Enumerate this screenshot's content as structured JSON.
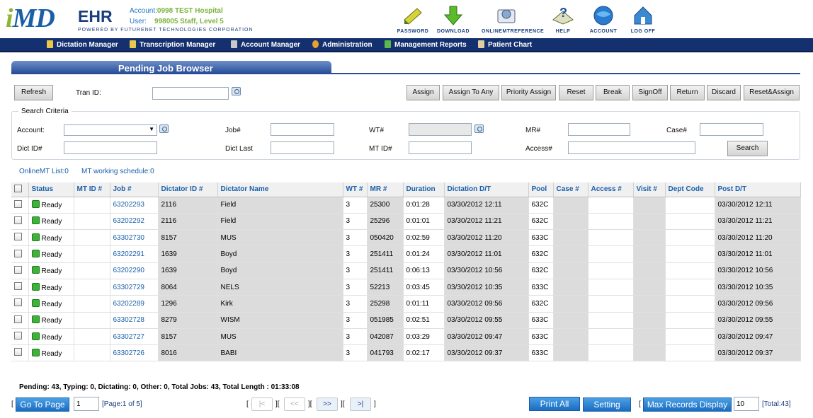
{
  "header": {
    "logo_i": "i",
    "logo_md": "MD",
    "logo_ehr": "EHR",
    "powered": "POWERED BY FUTURENET TECHNOLOGIES CORPORATION",
    "account_label": "Account:",
    "account_value": "0998 TEST Hospital",
    "user_label": "User:",
    "user_value": "998005 Staff, Level 5",
    "tools": [
      "PASSWORD",
      "DOWNLOAD",
      "ONLINEMTREFERENCE",
      "HELP",
      "ACCOUNT",
      "LOG OFF"
    ]
  },
  "nav": [
    "Dictation Manager",
    "Transcription Manager",
    "Account Manager",
    "Administration",
    "Management Reports",
    "Patient Chart"
  ],
  "title": "Pending Job Browser",
  "toolbar": {
    "refresh": "Refresh",
    "tran_id_label": "Tran ID:",
    "assign": "Assign",
    "assign_any": "Assign To Any",
    "priority_assign": "Priority Assign",
    "reset": "Reset",
    "break": "Break",
    "signoff": "SignOff",
    "return": "Return",
    "discard": "Discard",
    "reset_assign": "Reset&Assign"
  },
  "criteria": {
    "legend": "Search Criteria",
    "account": "Account:",
    "job": "Job#",
    "wt": "WT#",
    "mr": "MR#",
    "case": "Case#",
    "dict_id": "Dict ID#",
    "dict_last": "Dict Last",
    "mt_id": "MT ID#",
    "access": "Access#",
    "search": "Search"
  },
  "online": {
    "mt_list": "OnlineMT List:0",
    "schedule": "MT working schedule:0"
  },
  "columns": [
    "Status",
    "MT ID #",
    "Job #",
    "Dictator ID #",
    "Dictator Name",
    "WT #",
    "MR #",
    "Duration",
    "Dictation D/T",
    "Pool",
    "Case #",
    "Access #",
    "Visit #",
    "Dept Code",
    "Post D/T"
  ],
  "rows": [
    [
      "Ready",
      "",
      "63202293",
      "2116",
      "Field",
      "3",
      "25300",
      "0:01:28",
      "03/30/2012 12:11",
      "632C",
      "",
      "",
      "",
      "",
      "03/30/2012 12:11"
    ],
    [
      "Ready",
      "",
      "63202292",
      "2116",
      "Field",
      "3",
      "25296",
      "0:01:01",
      "03/30/2012 11:21",
      "632C",
      "",
      "",
      "",
      "",
      "03/30/2012 11:21"
    ],
    [
      "Ready",
      "",
      "63302730",
      "8157",
      "MUS",
      "3",
      "050420",
      "0:02:59",
      "03/30/2012 11:20",
      "633C",
      "",
      "",
      "",
      "",
      "03/30/2012 11:20"
    ],
    [
      "Ready",
      "",
      "63202291",
      "1639",
      "Boyd",
      "3",
      "251411",
      "0:01:24",
      "03/30/2012 11:01",
      "632C",
      "",
      "",
      "",
      "",
      "03/30/2012 11:01"
    ],
    [
      "Ready",
      "",
      "63202290",
      "1639",
      "Boyd",
      "3",
      "251411",
      "0:06:13",
      "03/30/2012 10:56",
      "632C",
      "",
      "",
      "",
      "",
      "03/30/2012 10:56"
    ],
    [
      "Ready",
      "",
      "63302729",
      "8064",
      "NELS",
      "3",
      "52213",
      "0:03:45",
      "03/30/2012 10:35",
      "633C",
      "",
      "",
      "",
      "",
      "03/30/2012 10:35"
    ],
    [
      "Ready",
      "",
      "63202289",
      "1296",
      "Kirk",
      "3",
      "25298",
      "0:01:11",
      "03/30/2012 09:56",
      "632C",
      "",
      "",
      "",
      "",
      "03/30/2012 09:56"
    ],
    [
      "Ready",
      "",
      "63302728",
      "8279",
      "WISM",
      "3",
      "051985",
      "0:02:51",
      "03/30/2012 09:55",
      "633C",
      "",
      "",
      "",
      "",
      "03/30/2012 09:55"
    ],
    [
      "Ready",
      "",
      "63302727",
      "8157",
      "MUS",
      "3",
      "042087",
      "0:03:29",
      "03/30/2012 09:47",
      "633C",
      "",
      "",
      "",
      "",
      "03/30/2012 09:47"
    ],
    [
      "Ready",
      "",
      "63302726",
      "8016",
      "BABI",
      "3",
      "041793",
      "0:02:17",
      "03/30/2012 09:37",
      "633C",
      "",
      "",
      "",
      "",
      "03/30/2012 09:37"
    ]
  ],
  "summary": "Pending: 43, Typing: 0, Dictating: 0, Other: 0, Total Jobs: 43, Total Length : 01:33:08",
  "footer": {
    "go_to_page": "Go To Page",
    "page_value": "1",
    "page_info": "[Page:1 of 5]",
    "first": "|<",
    "prev": "<<",
    "next": ">>",
    "last": ">|",
    "print_all": "Print All",
    "setting": "Setting",
    "max_records": "Max Records Display",
    "max_value": "10",
    "total": "[Total:43]"
  }
}
